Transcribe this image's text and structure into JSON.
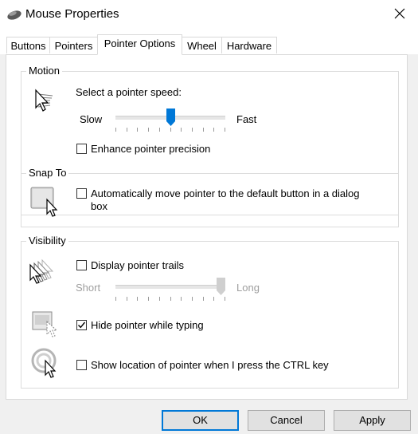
{
  "window": {
    "title": "Mouse Properties",
    "icon": "mouse-icon",
    "close_icon": "close-icon"
  },
  "tabs": [
    {
      "label": "Buttons",
      "active": false
    },
    {
      "label": "Pointers",
      "active": false
    },
    {
      "label": "Pointer Options",
      "active": true
    },
    {
      "label": "Wheel",
      "active": false
    },
    {
      "label": "Hardware",
      "active": false
    }
  ],
  "motion": {
    "title": "Motion",
    "speed_label": "Select a pointer speed:",
    "slow_label": "Slow",
    "fast_label": "Fast",
    "speed_level": 0.5,
    "enhance_label": "Enhance pointer precision",
    "enhance_checked": false
  },
  "snap_to": {
    "title": "Snap To",
    "snap_label_line1": "Automatically move pointer to the default button in a dialog",
    "snap_label_line2": "box",
    "snap_checked": false
  },
  "visibility": {
    "title": "Visibility",
    "trails_label": "Display pointer trails",
    "trails_checked": false,
    "short_label": "Short",
    "long_label": "Long",
    "trails_level": 1.0,
    "hide_label": "Hide pointer while typing",
    "hide_checked": true,
    "ctrl_label": "Show location of pointer when I press the CTRL key",
    "ctrl_checked": false
  },
  "buttons": {
    "ok": "OK",
    "cancel": "Cancel",
    "apply": "Apply"
  },
  "colors": {
    "accent": "#0078d7",
    "disabled_text": "#9e9e9e"
  }
}
